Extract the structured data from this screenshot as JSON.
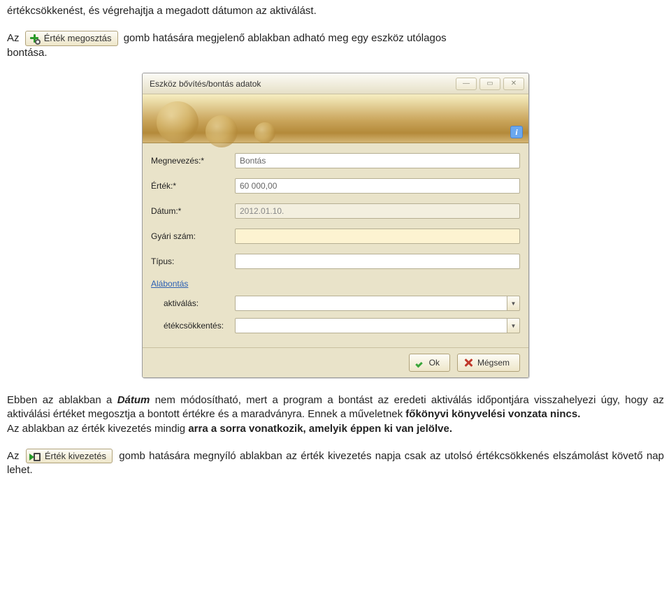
{
  "top_line": "értékcsökkenést, és végrehajtja a megadott dátumon az aktiválást.",
  "para1_pre": "Az ",
  "btn_share_label": "Érték megosztás",
  "para1_mid": " gomb hatására megjelenő ablakban adható meg egy eszköz utólagos",
  "para1_end": "bontása.",
  "window": {
    "title": "Eszköz bővítés/bontás adatok",
    "info_glyph": "i",
    "min": "—",
    "max": "▭",
    "close": "✕",
    "labels": {
      "megnevezes": "Megnevezés:*",
      "ertek": "Érték:*",
      "datum": "Dátum:*",
      "gyari": "Gyári szám:",
      "tipus": "Típus:",
      "alabontas": "Alábontás",
      "aktivalas": "aktiválás:",
      "etek": "étékcsökkentés:"
    },
    "values": {
      "megnevezes": "Bontás",
      "ertek": "60 000,00",
      "datum": "2012.01.10.",
      "gyari": "",
      "tipus": "",
      "aktivalas": "",
      "etek": ""
    },
    "ok": "Ok",
    "cancel": "Mégsem",
    "dd_glyph": "▼"
  },
  "para2_a": "Ebben az ablakban a ",
  "para2_datum_word": "Dátum",
  "para2_b": " nem módosítható, mert a program a bontást az eredeti aktiválás időpontjára visszahelyezi úgy, hogy az aktiválási értéket megosztja a bontott értékre és a maradványra. Ennek a műveletnek ",
  "para2_bold1": "főkönyvi könyvelési vonzata nincs.",
  "para2_c": "Az ablakban az érték kivezetés mindig ",
  "para2_bold2": "arra a sorra vonatkozik, amelyik éppen ki van jelölve.",
  "para3_pre": "Az ",
  "btn_out_label": "Érték kivezetés",
  "para3_rest": " gomb hatására megnyíló ablakban az érték kivezetés napja csak az utolsó értékcsökkenés elszámolást követő nap lehet."
}
